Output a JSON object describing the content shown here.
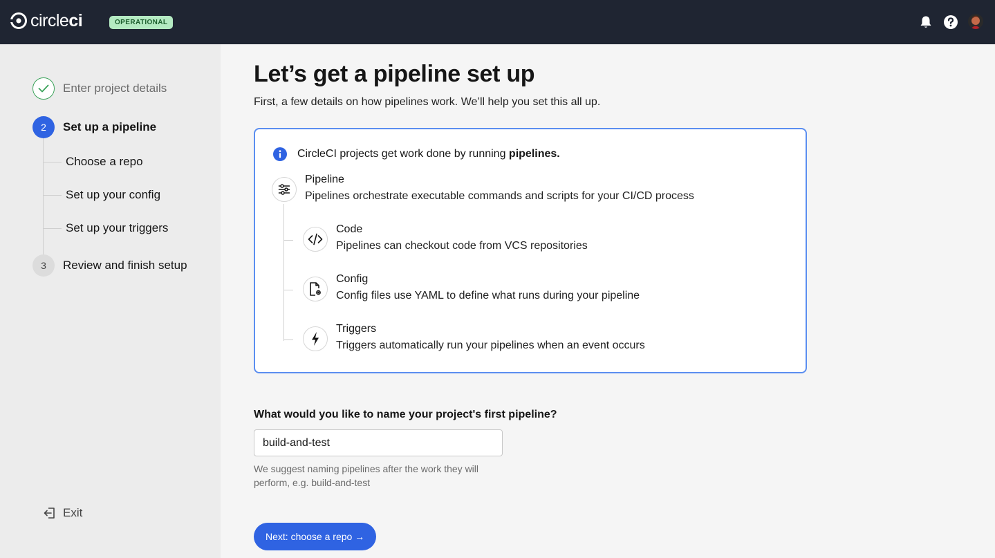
{
  "app": {
    "logo_text_light": "circle",
    "logo_text_bold": "ci",
    "status_badge": "OPERATIONAL"
  },
  "topbar": {
    "icons": [
      "bell-icon",
      "help-icon",
      "avatar"
    ]
  },
  "sidebar": {
    "steps": [
      {
        "number": "",
        "label": "Enter project details",
        "state": "done"
      },
      {
        "number": "2",
        "label": "Set up a pipeline",
        "state": "active"
      },
      {
        "number": "3",
        "label": "Review and finish setup",
        "state": "todo"
      }
    ],
    "substeps": [
      {
        "label": "Choose a repo"
      },
      {
        "label": "Set up your config"
      },
      {
        "label": "Set up your triggers"
      }
    ],
    "exit_label": "Exit"
  },
  "main": {
    "title": "Let’s get a pipeline set up",
    "subtitle": "First, a few details on how pipelines work. We’ll help you set this all up.",
    "info": {
      "intro_prefix": "CircleCI projects get work done by running ",
      "intro_bold": "pipelines.",
      "items": [
        {
          "title": "Pipeline",
          "desc": "Pipelines orchestrate executable commands and scripts for your CI/CD process",
          "icon": "sliders-icon"
        },
        {
          "title": "Code",
          "desc": "Pipelines can checkout code from VCS repositories",
          "icon": "code-icon"
        },
        {
          "title": "Config",
          "desc": "Config files use YAML to define what runs during your pipeline",
          "icon": "config-file-icon"
        },
        {
          "title": "Triggers",
          "desc": "Triggers automatically run your pipelines when an event occurs",
          "icon": "lightning-icon"
        }
      ]
    },
    "name_question": "What would you like to name your project's first pipeline?",
    "name_value": "build-and-test",
    "name_hint": "We suggest naming pipelines after the work they will perform, e.g. build-and-test",
    "next_button": "Next: choose a repo →"
  },
  "colors": {
    "accent": "#2f63e2",
    "topbar": "#1f2532",
    "success": "#3ba35a",
    "status_badge_bg": "#b4eac2"
  }
}
